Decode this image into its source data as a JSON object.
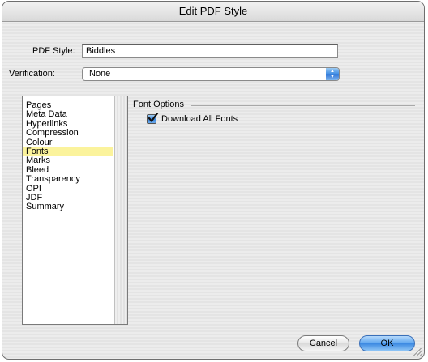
{
  "window": {
    "title": "Edit PDF Style"
  },
  "form": {
    "style_label": "PDF Style:",
    "style_value": "Biddles",
    "verification_label": "Verification:",
    "verification_value": "None"
  },
  "sidebar": {
    "items": [
      {
        "label": "Pages"
      },
      {
        "label": "Meta Data"
      },
      {
        "label": "Hyperlinks"
      },
      {
        "label": "Compression"
      },
      {
        "label": "Colour"
      },
      {
        "label": "Fonts",
        "selected": true
      },
      {
        "label": "Marks"
      },
      {
        "label": "Bleed"
      },
      {
        "label": "Transparency"
      },
      {
        "label": "OPI"
      },
      {
        "label": "JDF"
      },
      {
        "label": "Summary"
      }
    ]
  },
  "font_options": {
    "group_title": "Font Options",
    "download_all_label": "Download All Fonts",
    "download_all_checked": true
  },
  "buttons": {
    "cancel": "Cancel",
    "ok": "OK"
  },
  "colors": {
    "selection": "#fbf39c",
    "accent_blue": "#3b89e2"
  }
}
